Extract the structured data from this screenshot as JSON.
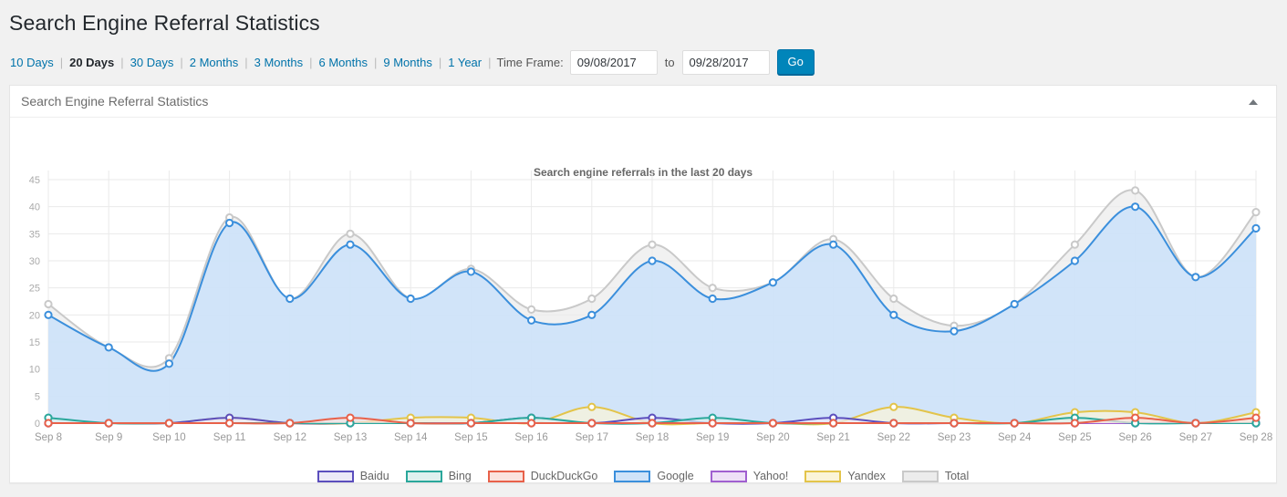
{
  "page": {
    "title": "Search Engine Referral Statistics"
  },
  "filters": {
    "ranges": [
      {
        "label": "10 Days",
        "active": false
      },
      {
        "label": "20 Days",
        "active": true
      },
      {
        "label": "30 Days",
        "active": false
      },
      {
        "label": "2 Months",
        "active": false
      },
      {
        "label": "3 Months",
        "active": false
      },
      {
        "label": "6 Months",
        "active": false
      },
      {
        "label": "9 Months",
        "active": false
      },
      {
        "label": "1 Year",
        "active": false
      }
    ],
    "separator": "|",
    "time_frame_label": "Time Frame:",
    "from_value": "09/08/2017",
    "from_placeholder": "mm/dd/yyyy",
    "to_label": "to",
    "to_value": "09/28/2017",
    "to_placeholder": "mm/dd/yyyy",
    "go_label": "Go"
  },
  "panel": {
    "title": "Search Engine Referral Statistics",
    "toggle_icon": "caret-up-icon"
  },
  "chart_data": {
    "type": "area",
    "title": "Search engine referrals in the last 20 days",
    "xlabel": "",
    "ylabel": "",
    "ylim": [
      0,
      45
    ],
    "ytick_step": 5,
    "yticks": [
      0,
      5,
      10,
      15,
      20,
      25,
      30,
      35,
      40,
      45
    ],
    "grid": true,
    "legend_position": "bottom",
    "categories": [
      "Sep 8",
      "Sep 9",
      "Sep 10",
      "Sep 11",
      "Sep 12",
      "Sep 13",
      "Sep 14",
      "Sep 15",
      "Sep 16",
      "Sep 17",
      "Sep 18",
      "Sep 19",
      "Sep 20",
      "Sep 21",
      "Sep 22",
      "Sep 23",
      "Sep 24",
      "Sep 25",
      "Sep 26",
      "Sep 27",
      "Sep 28"
    ],
    "series": [
      {
        "name": "Baidu",
        "color": "#5b4ebd",
        "fill": "#ece9f7",
        "values": [
          0,
          0,
          0,
          1,
          0,
          0,
          0,
          0,
          1,
          0,
          1,
          0,
          0,
          1,
          0,
          0,
          0,
          0,
          0,
          0,
          0
        ]
      },
      {
        "name": "Bing",
        "color": "#2aa79b",
        "fill": "#dff1ef",
        "values": [
          1,
          0,
          0,
          0,
          0,
          0,
          0,
          0,
          1,
          0,
          0,
          1,
          0,
          0,
          0,
          0,
          0,
          1,
          0,
          0,
          0
        ]
      },
      {
        "name": "DuckDuckGo",
        "color": "#e8614a",
        "fill": "#fbe3de",
        "values": [
          0,
          0,
          0,
          0,
          0,
          1,
          0,
          0,
          0,
          0,
          0,
          0,
          0,
          0,
          0,
          0,
          0,
          0,
          1,
          0,
          1
        ]
      },
      {
        "name": "Google",
        "color": "#3b8fdc",
        "fill": "#cfe3f9",
        "values": [
          20,
          14,
          11,
          37,
          23,
          33,
          23,
          28,
          19,
          20,
          30,
          23,
          26,
          33,
          20,
          17,
          22,
          30,
          40,
          27,
          36
        ]
      },
      {
        "name": "Yahoo!",
        "color": "#a05fd0",
        "fill": "#eee0f7",
        "values": [
          0,
          0,
          0,
          0,
          0,
          0,
          0,
          0,
          0,
          0,
          0,
          0,
          0,
          0,
          0,
          0,
          0,
          0,
          0,
          0,
          0
        ]
      },
      {
        "name": "Yandex",
        "color": "#e3c44a",
        "fill": "#fbf4d8",
        "values": [
          0,
          0,
          0,
          1,
          0,
          0,
          1,
          1,
          0,
          3,
          0,
          0,
          0,
          0,
          3,
          1,
          0,
          2,
          2,
          0,
          2
        ]
      },
      {
        "name": "Total",
        "color": "#c9c9c9",
        "fill": "#ececec",
        "values": [
          22,
          14,
          12,
          38,
          23,
          35,
          23,
          28.5,
          21,
          23,
          33,
          25,
          26,
          34,
          23,
          18,
          22,
          33,
          43,
          27,
          39
        ]
      }
    ]
  }
}
